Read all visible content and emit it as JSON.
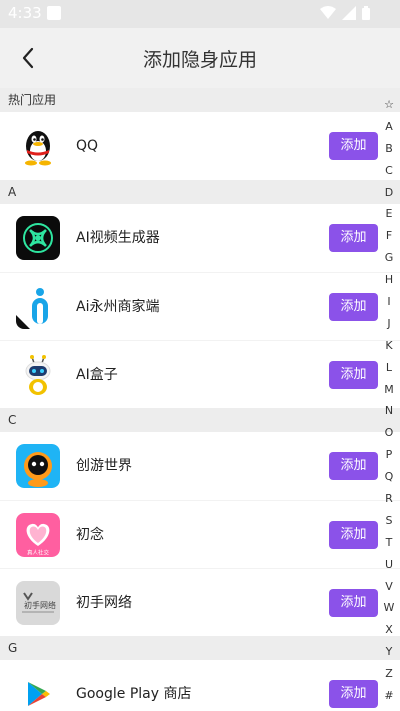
{
  "status_bar": {
    "time": "4:33"
  },
  "header": {
    "title": "添加隐身应用"
  },
  "sections": [
    {
      "header": "热门应用",
      "apps": [
        {
          "name": "QQ",
          "icon": "qq-icon",
          "add_label": "添加"
        }
      ]
    },
    {
      "header": "A",
      "apps": [
        {
          "name": "AI视频生成器",
          "icon": "ai-video-generator-icon",
          "add_label": "添加"
        },
        {
          "name": "Ai永州商家端",
          "icon": "ai-yongzhou-merchant-icon",
          "add_label": "添加"
        },
        {
          "name": "AI盒子",
          "icon": "ai-box-robot-icon",
          "add_label": "添加"
        }
      ]
    },
    {
      "header": "C",
      "apps": [
        {
          "name": "创游世界",
          "icon": "chuangyou-world-icon",
          "add_label": "添加"
        },
        {
          "name": "初念",
          "icon": "chunian-heart-icon",
          "add_label": "添加"
        },
        {
          "name": "初手网络",
          "icon": "chushou-network-icon",
          "add_label": "添加"
        }
      ]
    },
    {
      "header": "G",
      "apps": [
        {
          "name": "Google Play 商店",
          "icon": "google-play-store-icon",
          "add_label": "添加"
        }
      ]
    }
  ],
  "index_bar": [
    "☆",
    "A",
    "B",
    "C",
    "D",
    "E",
    "F",
    "G",
    "H",
    "I",
    "J",
    "K",
    "L",
    "M",
    "N",
    "O",
    "P",
    "Q",
    "R",
    "S",
    "T",
    "U",
    "V",
    "W",
    "X",
    "Y",
    "Z",
    "#"
  ],
  "icon_texts": {
    "chunian_tagline": "真人社交",
    "chushou_logo_text": "初手网络"
  },
  "colors": {
    "accent": "#8b52e9",
    "section_bg": "#ededed",
    "app_bar_bg": "#f1f1f1"
  }
}
